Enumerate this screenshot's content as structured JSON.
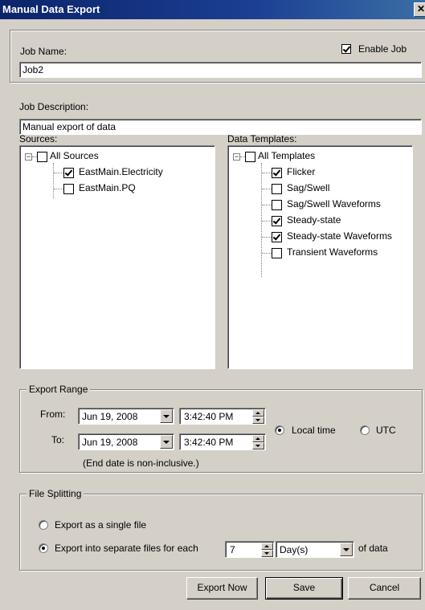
{
  "window": {
    "title": "Manual Data Export",
    "close_glyph": "✕"
  },
  "job": {
    "name_label": "Job Name:",
    "name_value": "Job2",
    "enable_label": "Enable Job",
    "enable_checked": true,
    "desc_label": "Job Description:",
    "desc_value": "Manual export of data"
  },
  "sources": {
    "label": "Sources:",
    "root": {
      "label": "All Sources",
      "checked": false
    },
    "items": [
      {
        "label": "EastMain.Electricity",
        "checked": true
      },
      {
        "label": "EastMain.PQ",
        "checked": false
      }
    ]
  },
  "templates": {
    "label": "Data Templates:",
    "root": {
      "label": "All Templates",
      "checked": false
    },
    "items": [
      {
        "label": "Flicker",
        "checked": true
      },
      {
        "label": "Sag/Swell",
        "checked": false
      },
      {
        "label": "Sag/Swell Waveforms",
        "checked": false
      },
      {
        "label": "Steady-state",
        "checked": true
      },
      {
        "label": "Steady-state Waveforms",
        "checked": true
      },
      {
        "label": "Transient Waveforms",
        "checked": false
      }
    ]
  },
  "export_range": {
    "title": "Export Range",
    "from_label": "From:",
    "to_label": "To:",
    "from_date": "Jun 19, 2008",
    "from_time": "3:42:40 PM",
    "to_date": "Jun 19, 2008",
    "to_time": "3:42:40 PM",
    "note": "(End date is non-inclusive.)",
    "tz_local": "Local time",
    "tz_utc": "UTC",
    "tz_selected": "Local time"
  },
  "file_splitting": {
    "title": "File Splitting",
    "single_label": "Export as a single file",
    "separate_label": "Export into separate files for each",
    "selected": "separate",
    "count": "7",
    "unit": "Day(s)",
    "suffix": "of data"
  },
  "buttons": {
    "export_now": "Export Now",
    "save": "Save",
    "cancel": "Cancel"
  },
  "icons": {
    "close": "close-icon",
    "expander": "collapse-icon",
    "dropdown": "chevron-down-icon",
    "spin": "spinner-arrows-icon"
  }
}
